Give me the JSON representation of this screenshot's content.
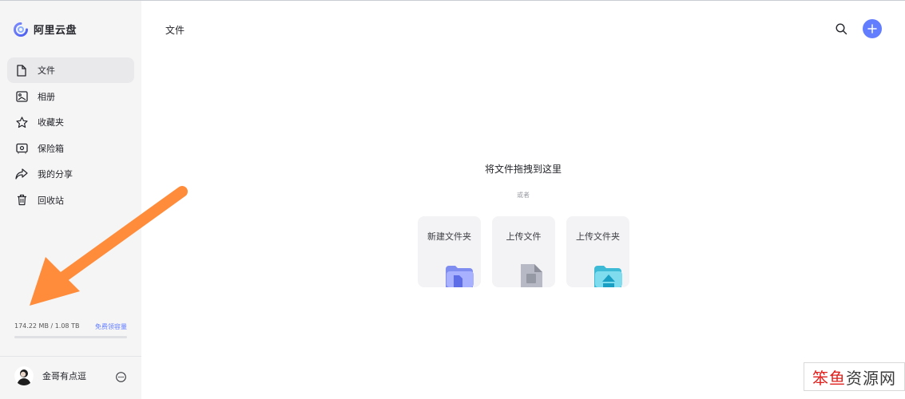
{
  "app": {
    "logo_text": "阿里云盘",
    "brand_color": "#637dff"
  },
  "sidebar": {
    "items": [
      {
        "label": "文件",
        "icon": "file-icon",
        "active": true
      },
      {
        "label": "相册",
        "icon": "photo-icon",
        "active": false
      },
      {
        "label": "收藏夹",
        "icon": "star-icon",
        "active": false
      },
      {
        "label": "保险箱",
        "icon": "safe-icon",
        "active": false
      },
      {
        "label": "我的分享",
        "icon": "share-icon",
        "active": false
      },
      {
        "label": "回收站",
        "icon": "trash-icon",
        "active": false
      }
    ],
    "storage": {
      "usage_text": "174.22 MB / 1.08 TB",
      "link_text": "免费领容量",
      "used_fraction": 0.0
    },
    "user": {
      "name": "金哥有点逗",
      "more_icon": "more-icon"
    }
  },
  "main": {
    "title": "文件",
    "search_icon": "search-icon",
    "add_icon": "plus-icon",
    "drop_title": "将文件拖拽到这里",
    "drop_or": "或者",
    "actions": [
      {
        "label": "新建文件夹",
        "icon": "new-folder-icon"
      },
      {
        "label": "上传文件",
        "icon": "upload-file-icon"
      },
      {
        "label": "上传文件夹",
        "icon": "upload-folder-icon"
      }
    ]
  },
  "overlay": {
    "arrow_color": "#ff8c3a",
    "watermark_part1": "笨鱼",
    "watermark_part2": "资源网"
  }
}
